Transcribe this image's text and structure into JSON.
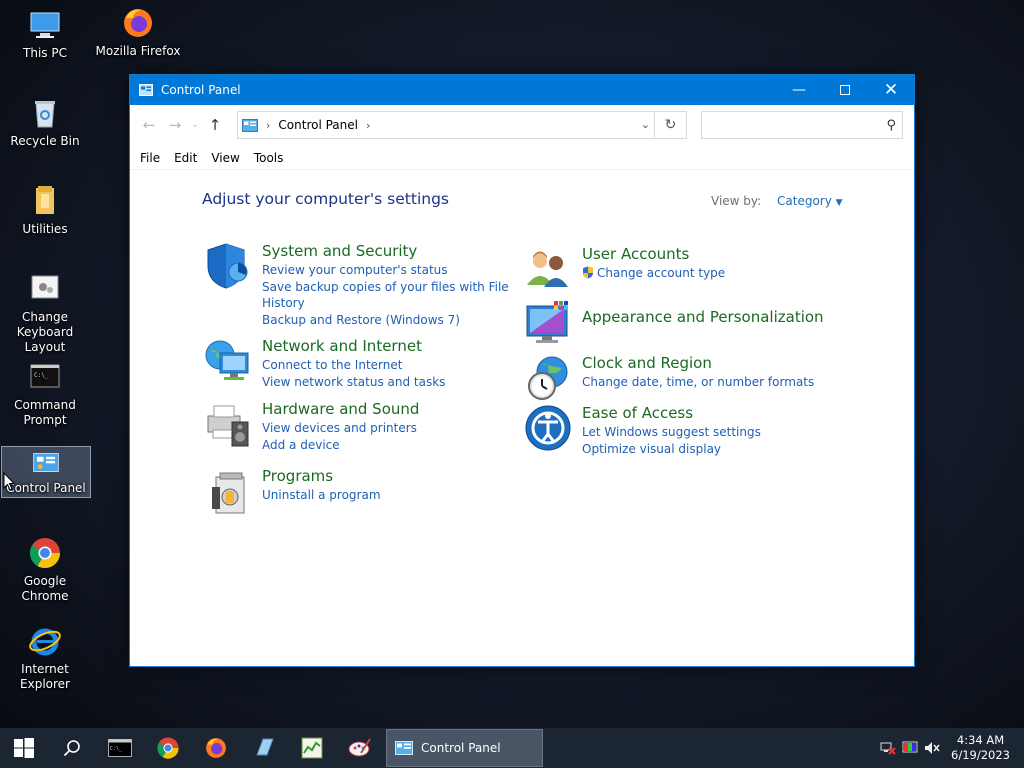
{
  "desktop": {
    "icons": [
      {
        "label": "This PC"
      },
      {
        "label": "Mozilla Firefox"
      },
      {
        "label": "Recycle Bin"
      },
      {
        "label": "Utilities"
      },
      {
        "label": "Change Keyboard Layout"
      },
      {
        "label": "Command Prompt"
      },
      {
        "label": "Control Panel"
      },
      {
        "label": "Google Chrome"
      },
      {
        "label": "Internet Explorer"
      }
    ]
  },
  "window": {
    "title": "Control Panel",
    "address": {
      "path_label": "Control Panel"
    },
    "search": {
      "value": "",
      "placeholder": ""
    },
    "menu": [
      "File",
      "Edit",
      "View",
      "Tools"
    ],
    "heading": "Adjust your computer's settings",
    "view_by": {
      "label": "View by:",
      "value": "Category"
    },
    "categories_left": [
      {
        "title": "System and Security",
        "links": [
          "Review your computer's status",
          "Save backup copies of your files with File",
          "History",
          "Backup and Restore (Windows 7)"
        ]
      },
      {
        "title": "Network and Internet",
        "links": [
          "Connect to the Internet",
          "View network status and tasks"
        ]
      },
      {
        "title": "Hardware and Sound",
        "links": [
          "View devices and printers",
          "Add a device"
        ]
      },
      {
        "title": "Programs",
        "links": [
          "Uninstall a program"
        ]
      }
    ],
    "categories_right": [
      {
        "title": "User Accounts",
        "links": [
          "Change account type"
        ]
      },
      {
        "title": "Appearance and Personalization",
        "links": []
      },
      {
        "title": "Clock and Region",
        "links": [
          "Change date, time, or number formats"
        ]
      },
      {
        "title": "Ease of Access",
        "links": [
          "Let Windows suggest settings",
          "Optimize visual display"
        ]
      }
    ]
  },
  "taskbar": {
    "active_window": "Control Panel",
    "clock": {
      "time": "4:34 AM",
      "date": "6/19/2023"
    }
  },
  "colors": {
    "accent": "#0078d7",
    "category_title": "#1a6a23",
    "link": "#1f5fb5",
    "heading": "#1e3287"
  }
}
